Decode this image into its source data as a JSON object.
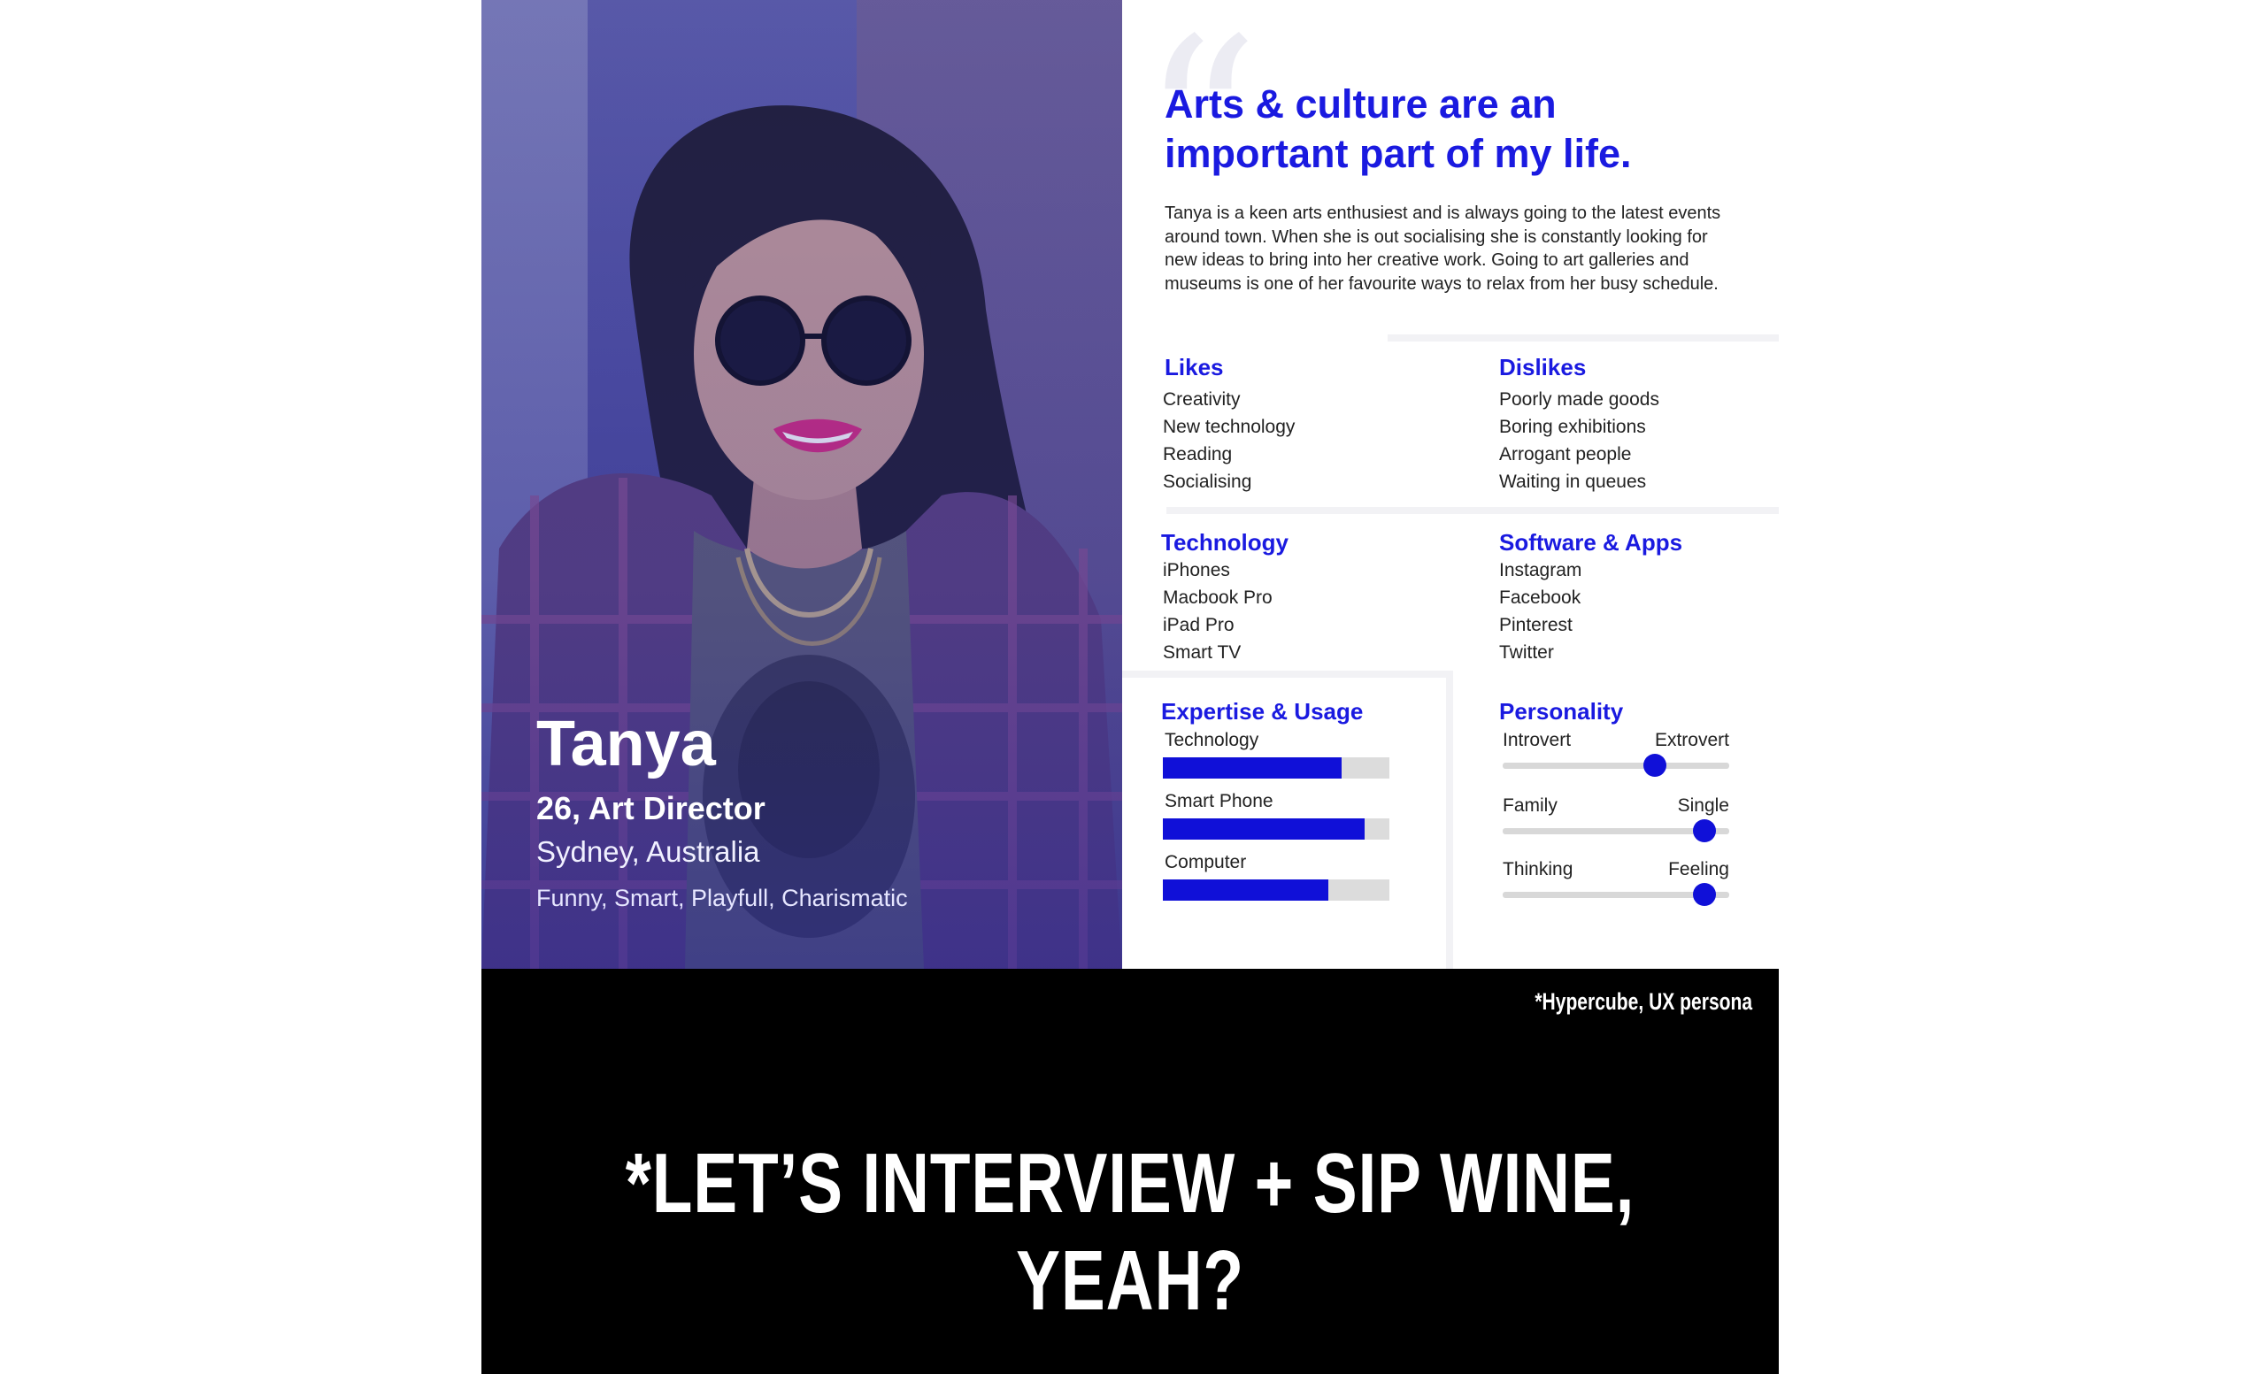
{
  "persona": {
    "name": "Tanya",
    "role": "26, Art Director",
    "location": "Sydney, Australia",
    "traits": "Funny, Smart, Playfull, Charismatic"
  },
  "quote": "Arts & culture are an important part of my life.",
  "bio": "Tanya is a keen arts enthusiest and is always going to the latest events around town. When she is out socialising she is constantly looking for new ideas to bring into her creative work. Going to art galleries and museums is one of her favourite ways to relax from her busy schedule.",
  "likes": {
    "title": "Likes",
    "items": [
      "Creativity",
      "New technology",
      "Reading",
      "Socialising"
    ]
  },
  "dislikes": {
    "title": "Dislikes",
    "items": [
      "Poorly made goods",
      "Boring exhibitions",
      "Arrogant people",
      "Waiting in queues"
    ]
  },
  "technology": {
    "title": "Technology",
    "items": [
      "iPhones",
      "Macbook Pro",
      "iPad Pro",
      "Smart TV"
    ]
  },
  "software": {
    "title": "Software & Apps",
    "items": [
      "Instagram",
      "Facebook",
      "Pinterest",
      "Twitter"
    ]
  },
  "expertise": {
    "title": "Expertise & Usage",
    "items": [
      {
        "label": "Technology",
        "value": 0.79
      },
      {
        "label": "Smart Phone",
        "value": 0.89
      },
      {
        "label": "Computer",
        "value": 0.73
      }
    ]
  },
  "personality": {
    "title": "Personality",
    "items": [
      {
        "left": "Introvert",
        "right": "Extrovert",
        "value": 0.67
      },
      {
        "left": "Family",
        "right": "Single",
        "value": 0.89
      },
      {
        "left": "Thinking",
        "right": "Feeling",
        "value": 0.89
      }
    ]
  },
  "credit": "*Hypercube, UX persona",
  "tagline": "*LET’S INTERVIEW + SIP WINE, YEAH?",
  "colors": {
    "accent": "#1a1ae0",
    "banner": "#000000"
  }
}
